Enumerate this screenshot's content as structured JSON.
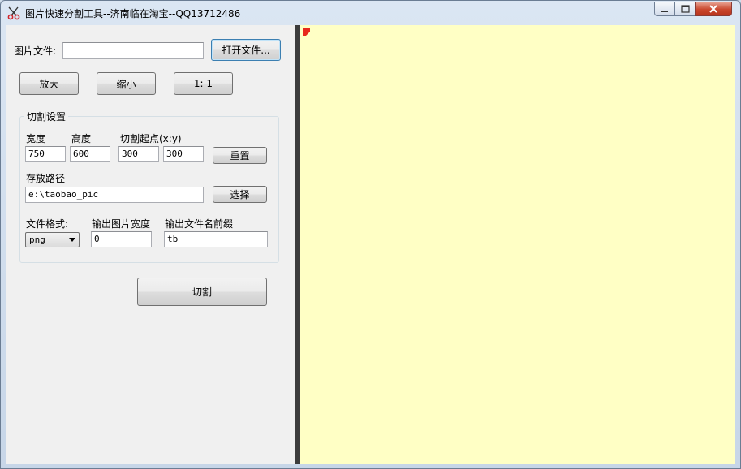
{
  "window": {
    "title": "图片快速分割工具--济南临在淘宝--QQ13712486",
    "controls": [
      "minimize",
      "maximize",
      "close"
    ]
  },
  "file_row": {
    "label": "图片文件:",
    "path_value": "",
    "open_button": "打开文件..."
  },
  "zoom": {
    "zoom_in": "放大",
    "zoom_out": "缩小",
    "actual_size": "1: 1"
  },
  "settings": {
    "group_title": "切割设置",
    "width_label": "宽度",
    "height_label": "高度",
    "origin_label": "切割起点(x:y)",
    "width_value": "750",
    "height_value": "600",
    "x_value": "300",
    "y_value": "300",
    "reset_button": "重置",
    "path_label": "存放路径",
    "path_value": "e:\\taobao_pic",
    "choose_button": "选择",
    "format_label": "文件格式:",
    "format_value": "png",
    "output_width_label": "输出图片宽度",
    "output_width_value": "0",
    "prefix_label": "输出文件名前缀",
    "prefix_value": "tb"
  },
  "cut_button": "切割",
  "icons": {
    "app": "scissors-icon",
    "canvas_marker": "red-corner-marker"
  },
  "colors": {
    "canvas_bg": "#ffffc5",
    "panel_bg": "#f0f0f0",
    "splitter": "#3c3c3c",
    "marker": "#e8291c",
    "close_button": "#c9462c"
  }
}
